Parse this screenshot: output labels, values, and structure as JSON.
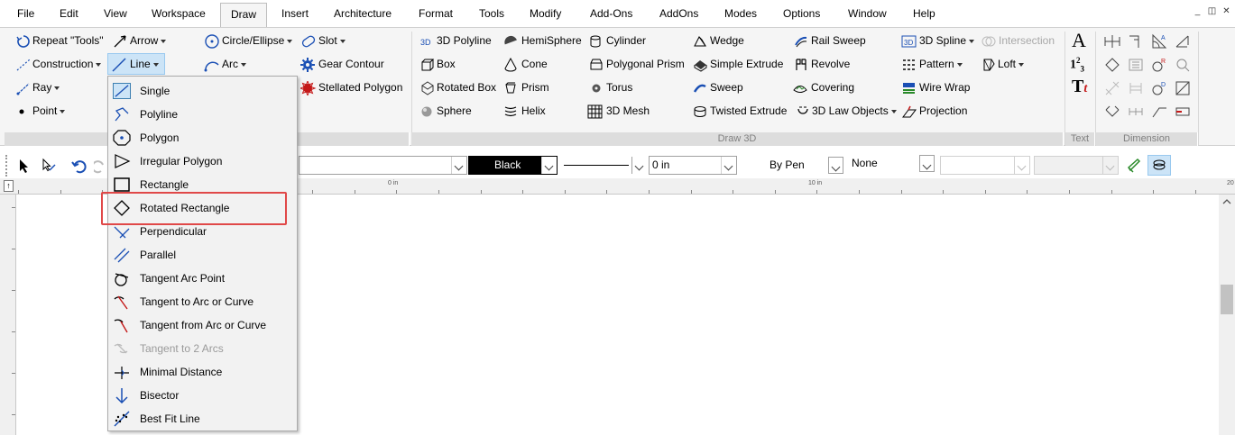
{
  "menubar": {
    "items": [
      "File",
      "Edit",
      "View",
      "Workspace",
      "Draw",
      "Insert",
      "Architecture",
      "Format",
      "Tools",
      "Modify",
      "Add-Ons",
      "AddOns",
      "Modes",
      "Options",
      "Window",
      "Help"
    ],
    "active": "Draw"
  },
  "ribbon": {
    "draw2d": {
      "repeat": "Repeat \"Tools\"",
      "arrow": "Arrow",
      "circle": "Circle/Ellipse",
      "slot": "Slot",
      "construction": "Construction",
      "line": "Line",
      "arc": "Arc",
      "gear": "Gear Contour",
      "ray": "Ray",
      "stellated": "Stellated Polygon",
      "point": "Point"
    },
    "draw3d": {
      "title": "Draw 3D",
      "polyline3d": "3D Polyline",
      "hemisphere": "HemiSphere",
      "cylinder": "Cylinder",
      "wedge": "Wedge",
      "railsweep": "Rail Sweep",
      "spline3d": "3D Spline",
      "intersection": "Intersection",
      "box": "Box",
      "cone": "Cone",
      "prism_polygonal": "Polygonal Prism",
      "simple_extrude": "Simple Extrude",
      "revolve": "Revolve",
      "pattern": "Pattern",
      "loft": "Loft",
      "rotated_box": "Rotated Box",
      "prism": "Prism",
      "torus": "Torus",
      "sweep": "Sweep",
      "covering": "Covering",
      "wirewrap": "Wire Wrap",
      "sphere": "Sphere",
      "helix": "Helix",
      "mesh3d": "3D Mesh",
      "twisted": "Twisted Extrude",
      "lawobjects": "3D Law Objects",
      "projection": "Projection"
    },
    "text": {
      "title": "Text"
    },
    "dimension": {
      "title": "Dimension"
    }
  },
  "toolbar": {
    "color": "Black",
    "thickness": "0 in",
    "pen": "By Pen",
    "fill": "None"
  },
  "ruler": {
    "labels": [
      "0 in",
      "10 in",
      "20"
    ]
  },
  "line_menu": {
    "items": [
      {
        "label": "Single",
        "icon": "single-line-icon",
        "enabled": true
      },
      {
        "label": "Polyline",
        "icon": "polyline-icon",
        "enabled": true
      },
      {
        "label": "Polygon",
        "icon": "polygon-icon",
        "enabled": true
      },
      {
        "label": "Irregular Polygon",
        "icon": "irregular-polygon-icon",
        "enabled": true
      },
      {
        "label": "Rectangle",
        "icon": "rectangle-icon",
        "enabled": true
      },
      {
        "label": "Rotated Rectangle",
        "icon": "rotated-rectangle-icon",
        "enabled": true
      },
      {
        "label": "Perpendicular",
        "icon": "perpendicular-icon",
        "enabled": true
      },
      {
        "label": "Parallel",
        "icon": "parallel-icon",
        "enabled": true
      },
      {
        "label": "Tangent Arc Point",
        "icon": "tangent-arc-point-icon",
        "enabled": true
      },
      {
        "label": "Tangent to Arc or Curve",
        "icon": "tangent-to-arc-icon",
        "enabled": true
      },
      {
        "label": "Tangent from Arc or Curve",
        "icon": "tangent-from-arc-icon",
        "enabled": true
      },
      {
        "label": "Tangent to 2 Arcs",
        "icon": "tangent-two-arcs-icon",
        "enabled": false
      },
      {
        "label": "Minimal Distance",
        "icon": "minimal-distance-icon",
        "enabled": true
      },
      {
        "label": "Bisector",
        "icon": "bisector-icon",
        "enabled": true
      },
      {
        "label": "Best Fit Line",
        "icon": "best-fit-line-icon",
        "enabled": true
      }
    ],
    "highlighted": "Rotated Rectangle"
  },
  "colors": {
    "accent": "#3c7fb1",
    "highlight_box": "#e04848",
    "icon_blue": "#1a4fb4"
  }
}
